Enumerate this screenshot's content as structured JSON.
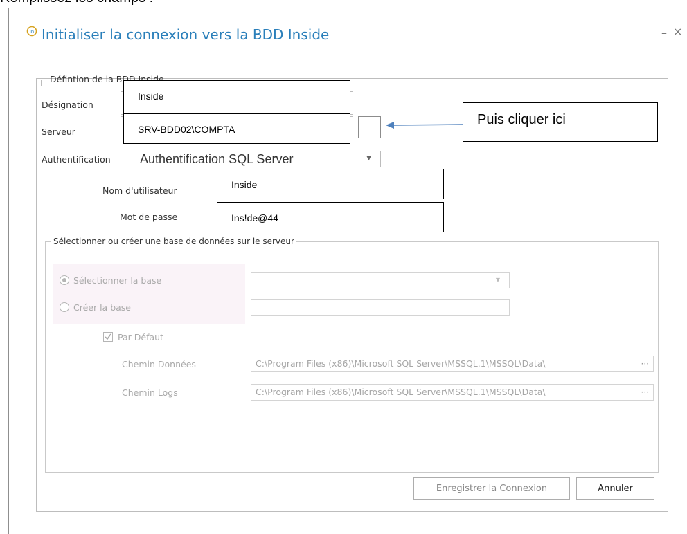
{
  "caption": "Remplissez les champs :",
  "window": {
    "title": "Initialiser la connexion vers la BDD Inside",
    "minimize": "–",
    "close": "×"
  },
  "definition": {
    "legend": "Défintion de la BDD Inside",
    "designation_label": "Désignation",
    "designation_value": "Inside",
    "serveur_label": "Serveur",
    "serveur_value": "SRV-BDD02\\COMPTA",
    "auth_label": "Authentification",
    "auth_value": "Authentification SQL Server",
    "username_label": "Nom d'utilisateur",
    "username_value": "Inside",
    "password_label": "Mot de passe",
    "password_value": "Ins!de@44"
  },
  "annotation": {
    "text": "Puis cliquer ici"
  },
  "database": {
    "legend": "Sélectionner ou créer une base de données sur le serveur",
    "select_label": "Sélectionner la base",
    "create_label": "Créer la base",
    "default_label": "Par Défaut",
    "data_path_label": "Chemin Données",
    "data_path_value": "C:\\Program Files (x86)\\Microsoft SQL Server\\MSSQL.1\\MSSQL\\Data\\",
    "logs_path_label": "Chemin Logs",
    "logs_path_value": "C:\\Program Files (x86)\\Microsoft SQL Server\\MSSQL.1\\MSSQL\\Data\\",
    "browse": "···"
  },
  "buttons": {
    "save_label_first": "E",
    "save_label_rest": "nregistrer la Connexion",
    "cancel_label_first": "A",
    "cancel_label_mnemonic": "n",
    "cancel_label_rest": "nuler"
  },
  "colors": {
    "title": "#2a7fba",
    "arrow": "#4f81bd",
    "disabled_panel": "#faf3f8"
  }
}
